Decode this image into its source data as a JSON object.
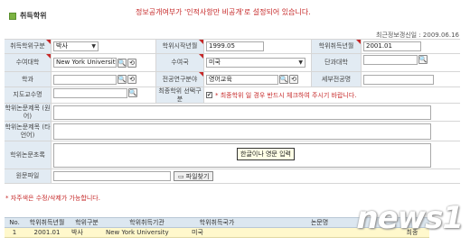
{
  "section_title": "취득학위",
  "notice": "정보공개여부가 '인적사항만 비공개'로 설정되어 있습니다.",
  "updated": "최근정보갱신일 : 2009.06.16",
  "form": {
    "degree_type_label": "취득학위구분",
    "degree_type_value": "박사",
    "start_date_label": "학위시작년월",
    "start_date_value": "1999.05",
    "acquire_date_label": "학위취득년월",
    "acquire_date_value": "2001.01",
    "univ_label": "수여대학",
    "univ_value": "New York University",
    "country_label": "수여국",
    "country_value": "미국",
    "college_label": "단과대학",
    "college_value": "",
    "dept_label": "학과",
    "dept_value": "",
    "major_label": "전공연구분야",
    "major_value": "영어교육",
    "detail_major_label": "세부전공명",
    "detail_major_value": "",
    "advisor_label": "지도교수명",
    "advisor_value": "",
    "final_degree_label": "최종학위 선택구분",
    "final_degree_note": "* 최종학위 일 경우 반드시 체크하여 주시기 바랍니다.",
    "thesis_title_label": "학위논문제목 (원어)",
    "thesis_title_foreign_label": "학위논문제목 (타언어)",
    "abstract_label": "학위논문초록",
    "tooltip": "한글이나 영문 입력",
    "file_label": "원문파일",
    "file_button": "파일찾기"
  },
  "footer_note": "* 자주색은 수정/삭제가 가능합니다.",
  "table": {
    "headers": [
      "No.",
      "학위취득년월",
      "학위구분",
      "학위취득기관",
      "학위취득국가",
      "논문명",
      ""
    ],
    "rows": [
      [
        "1",
        "2001.01",
        "박사",
        "New York University",
        "미국",
        "",
        "최종"
      ]
    ]
  },
  "watermark": "news1"
}
